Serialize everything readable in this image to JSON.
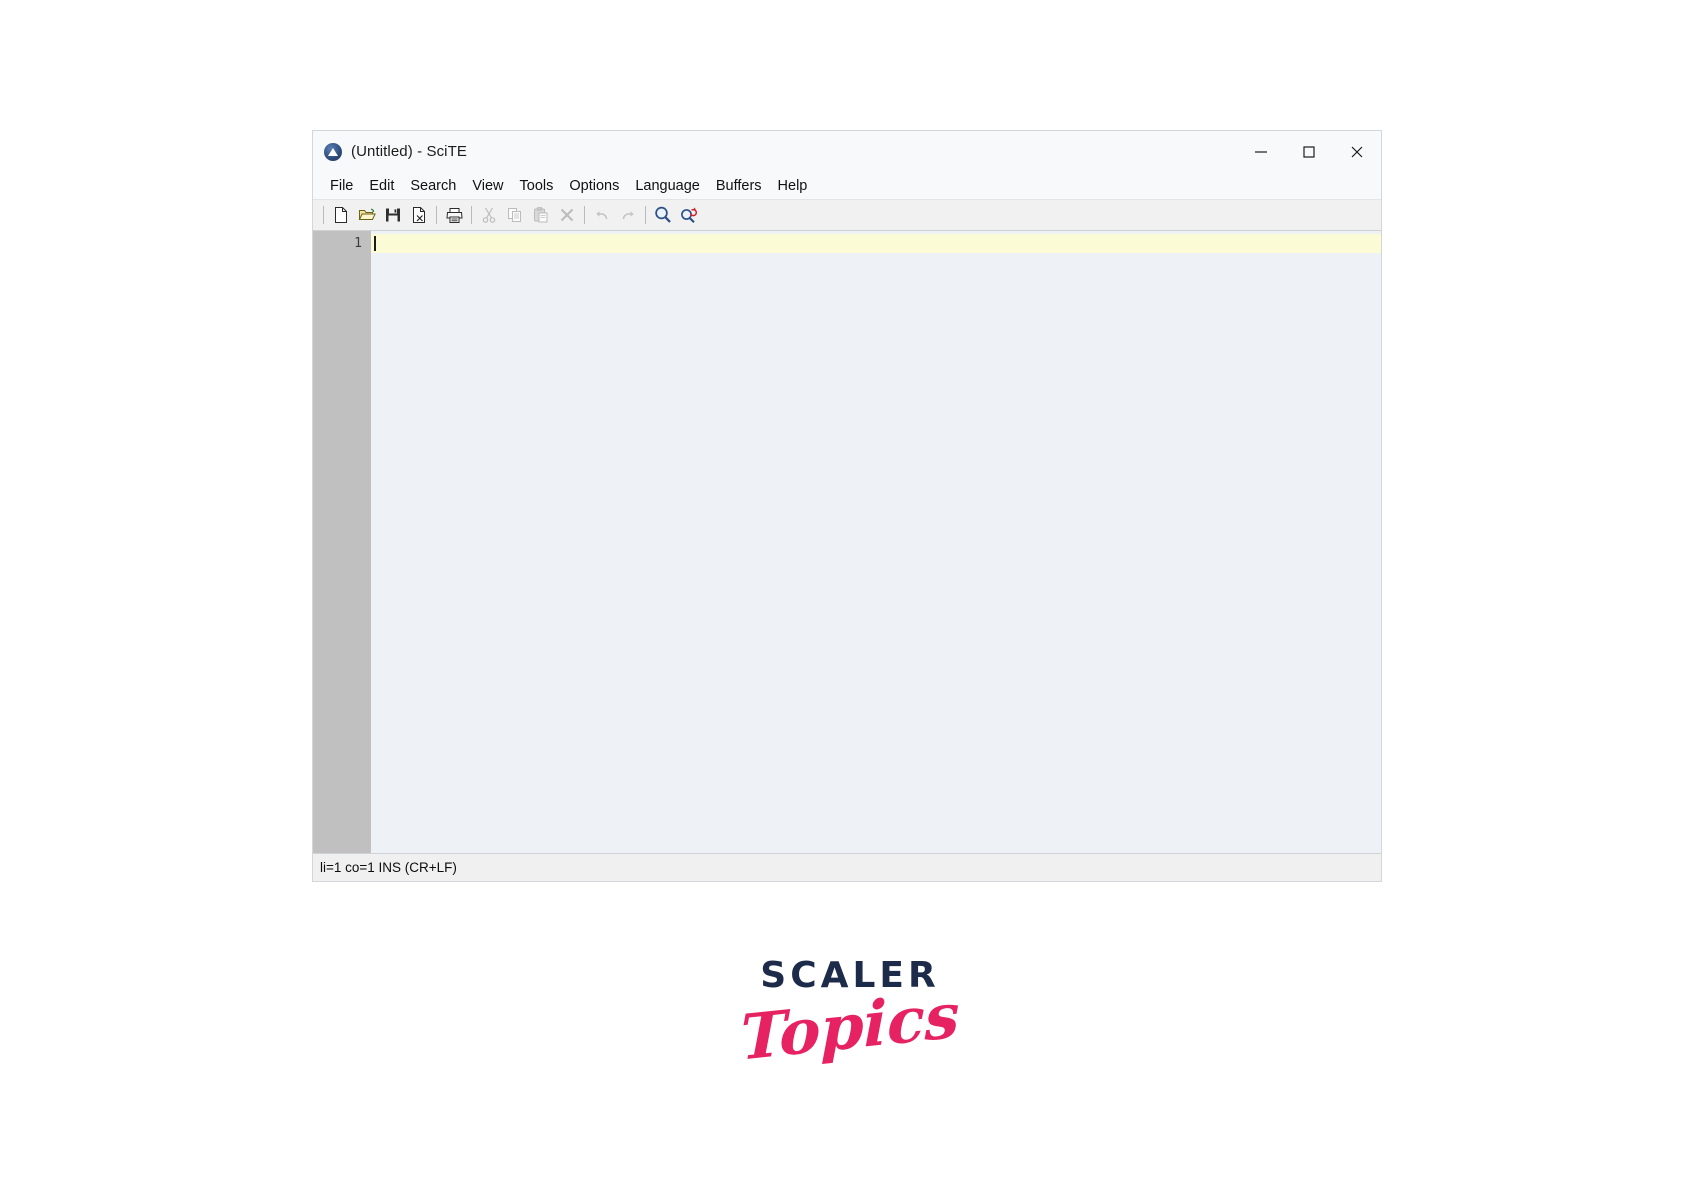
{
  "window": {
    "title": "(Untitled) - SciTE",
    "app_icon": "scite-app-icon",
    "controls": {
      "minimize": "minimize-icon",
      "maximize": "maximize-icon",
      "close": "close-icon"
    }
  },
  "menubar": {
    "items": [
      {
        "label": "File"
      },
      {
        "label": "Edit"
      },
      {
        "label": "Search"
      },
      {
        "label": "View"
      },
      {
        "label": "Tools"
      },
      {
        "label": "Options"
      },
      {
        "label": "Language"
      },
      {
        "label": "Buffers"
      },
      {
        "label": "Help"
      }
    ]
  },
  "toolbar": {
    "buttons": [
      {
        "name": "new-file-icon",
        "enabled": true
      },
      {
        "name": "open-file-icon",
        "enabled": true
      },
      {
        "name": "save-file-icon",
        "enabled": true
      },
      {
        "name": "close-file-icon",
        "enabled": true
      },
      {
        "name": "print-icon",
        "enabled": true
      },
      {
        "name": "cut-icon",
        "enabled": false
      },
      {
        "name": "copy-icon",
        "enabled": false
      },
      {
        "name": "paste-icon",
        "enabled": false
      },
      {
        "name": "delete-icon",
        "enabled": false
      },
      {
        "name": "undo-icon",
        "enabled": false
      },
      {
        "name": "redo-icon",
        "enabled": false
      },
      {
        "name": "find-icon",
        "enabled": true
      },
      {
        "name": "find-replace-icon",
        "enabled": true
      }
    ]
  },
  "editor": {
    "line_numbers": [
      "1"
    ],
    "content": "",
    "caret_line": 1,
    "colors": {
      "background": "#eef2f6",
      "gutter": "#c0c0c0",
      "current_line": "#fbfbd6"
    }
  },
  "statusbar": {
    "text": "li=1 co=1 INS (CR+LF)"
  },
  "logo": {
    "primary": "SCALER",
    "secondary": "Topics",
    "primary_color": "#1c2b4a",
    "secondary_color": "#e62263"
  }
}
